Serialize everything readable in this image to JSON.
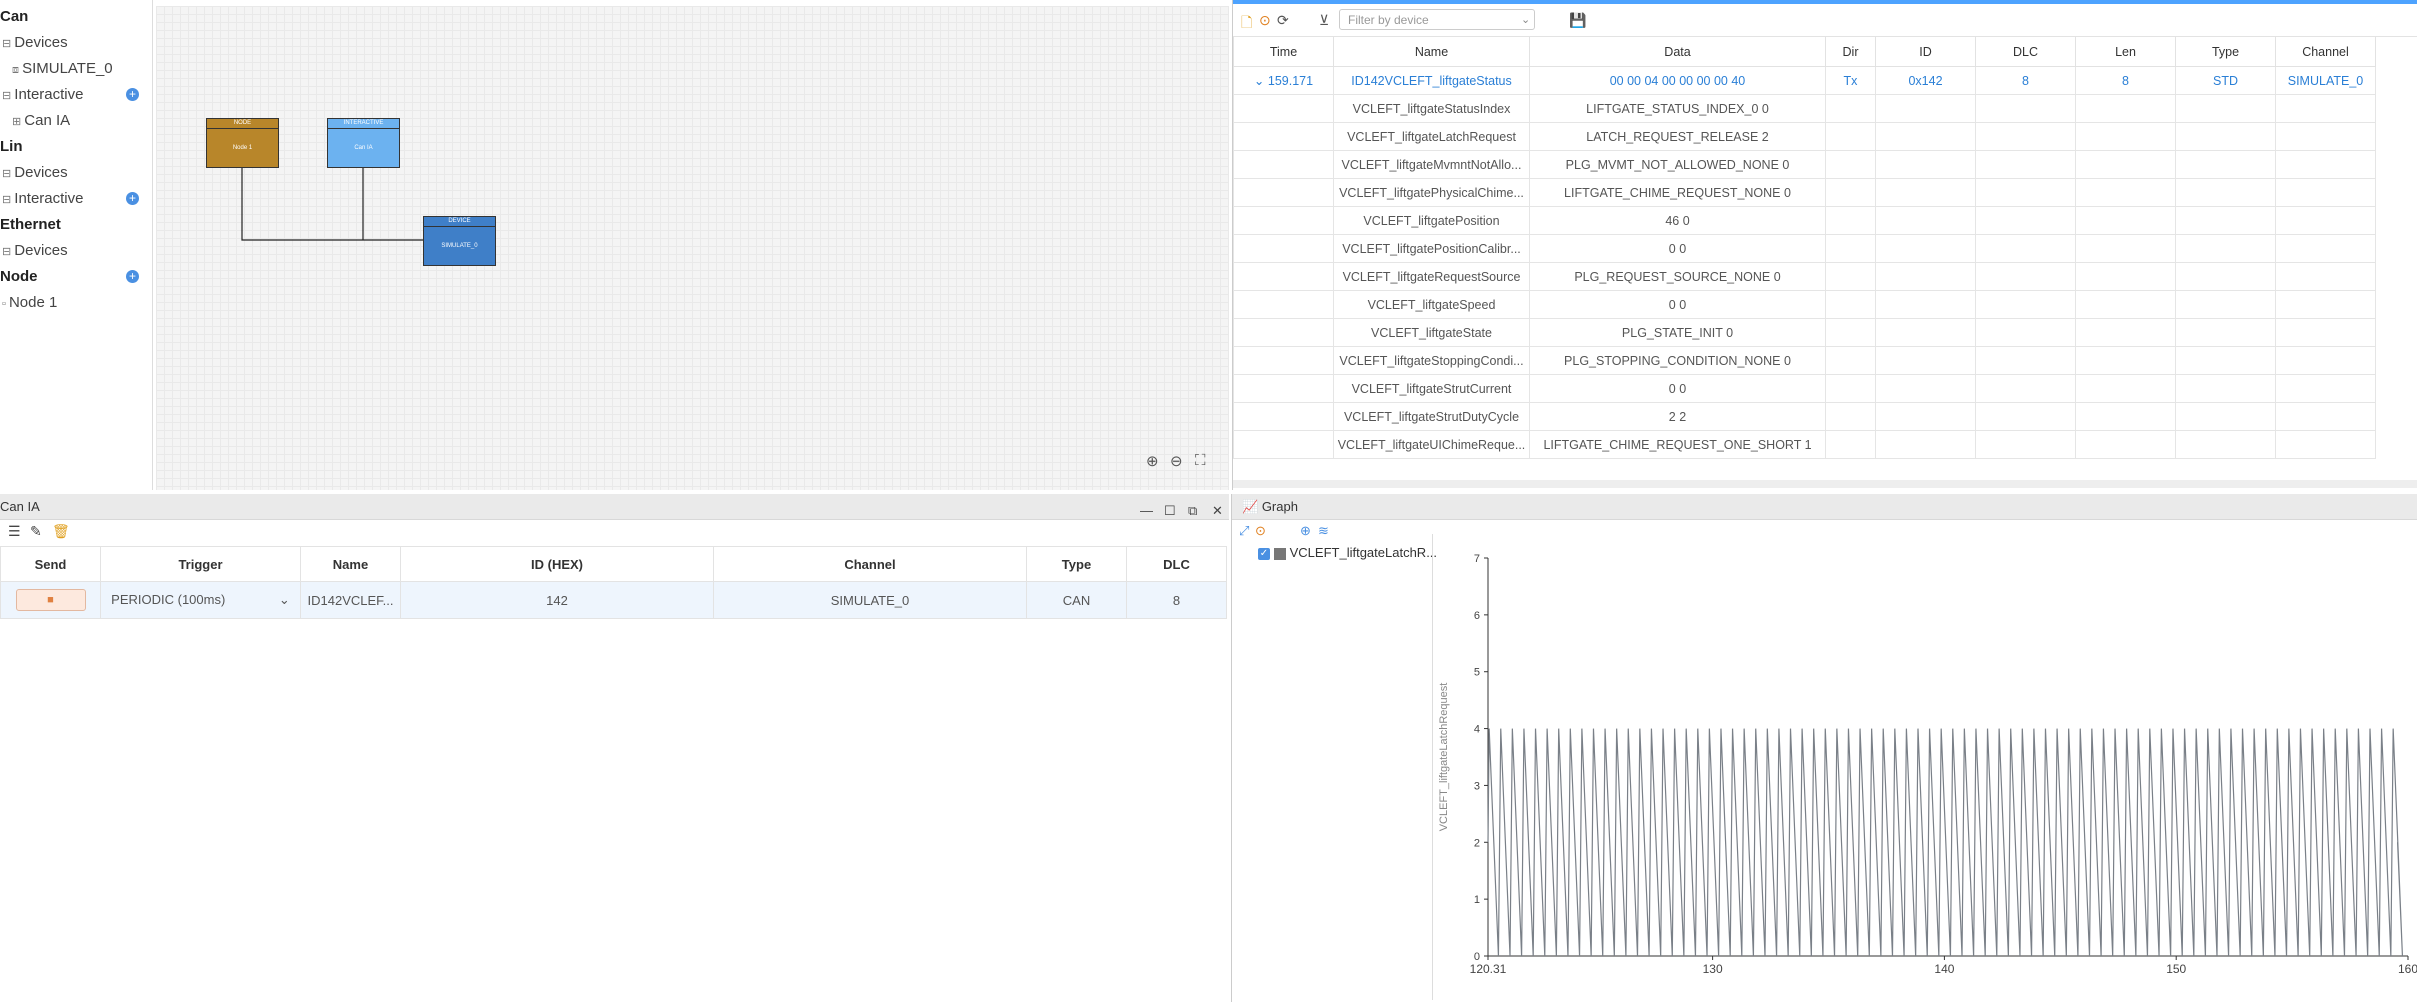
{
  "tree": {
    "sections": [
      {
        "label": "Can",
        "items": [
          {
            "label": "Devices",
            "children": [
              "SIMULATE_0"
            ]
          },
          {
            "label": "Interactive",
            "plus": true,
            "children": [
              "Can IA"
            ]
          }
        ]
      },
      {
        "label": "Lin",
        "items": [
          {
            "label": "Devices"
          },
          {
            "label": "Interactive",
            "plus": true
          }
        ]
      },
      {
        "label": "Ethernet",
        "items": [
          {
            "label": "Devices"
          }
        ]
      },
      {
        "label": "Node",
        "plus": true,
        "items": [
          {
            "label": "Node 1"
          }
        ]
      }
    ]
  },
  "canvas": {
    "nodes": [
      {
        "header": "NODE",
        "label": "Node 1",
        "color": "#b8862a"
      },
      {
        "header": "INTERACTIVE",
        "label": "Can IA",
        "color": "#6cb2f0"
      },
      {
        "header": "DEVICE",
        "label": "SIMULATE_0",
        "color": "#3f7fc8"
      }
    ]
  },
  "messages": {
    "filter_placeholder": "Filter by device",
    "columns": [
      "Time",
      "Name",
      "Data",
      "Dir",
      "ID",
      "DLC",
      "Len",
      "Type",
      "Channel"
    ],
    "main": {
      "time": "159.171",
      "name": "ID142VCLEFT_liftgateStatus",
      "data": "00 00 04 00 00 00 00 40",
      "dir": "Tx",
      "id": "0x142",
      "dlc": "8",
      "len": "8",
      "type": "STD",
      "channel": "SIMULATE_0"
    },
    "signals": [
      {
        "name": "VCLEFT_liftgateStatusIndex",
        "value": "LIFTGATE_STATUS_INDEX_0  0"
      },
      {
        "name": "VCLEFT_liftgateLatchRequest",
        "value": "LATCH_REQUEST_RELEASE  2"
      },
      {
        "name": "VCLEFT_liftgateMvmntNotAllo...",
        "value": "PLG_MVMT_NOT_ALLOWED_NONE  0"
      },
      {
        "name": "VCLEFT_liftgatePhysicalChime...",
        "value": "LIFTGATE_CHIME_REQUEST_NONE  0"
      },
      {
        "name": "VCLEFT_liftgatePosition",
        "value": "46  0"
      },
      {
        "name": "VCLEFT_liftgatePositionCalibr...",
        "value": "0  0"
      },
      {
        "name": "VCLEFT_liftgateRequestSource",
        "value": "PLG_REQUEST_SOURCE_NONE  0"
      },
      {
        "name": "VCLEFT_liftgateSpeed",
        "value": "0  0"
      },
      {
        "name": "VCLEFT_liftgateState",
        "value": "PLG_STATE_INIT  0"
      },
      {
        "name": "VCLEFT_liftgateStoppingCondi...",
        "value": "PLG_STOPPING_CONDITION_NONE  0"
      },
      {
        "name": "VCLEFT_liftgateStrutCurrent",
        "value": "0  0"
      },
      {
        "name": "VCLEFT_liftgateStrutDutyCycle",
        "value": "2  2"
      },
      {
        "name": "VCLEFT_liftgateUIChimeReque...",
        "value": "LIFTGATE_CHIME_REQUEST_ONE_SHORT  1"
      }
    ]
  },
  "canIA": {
    "title": "Can IA",
    "columns": [
      "Send",
      "Trigger",
      "Name",
      "ID (HEX)",
      "Channel",
      "Type",
      "DLC"
    ],
    "rows": [
      {
        "send": "■",
        "trigger": "PERIODIC   (100ms)",
        "name": "ID142VCLEF...",
        "id": "142",
        "channel": "SIMULATE_0",
        "type": "CAN",
        "dlc": "8"
      }
    ]
  },
  "graph": {
    "title": "Graph",
    "legend": "VCLEFT_liftgateLatchR...",
    "series_color": "#7a8088"
  },
  "chart_data": {
    "type": "line",
    "title": "",
    "xlabel": "",
    "ylabel": "VCLEFT_liftgateLatchRequest",
    "xlim": [
      120.31,
      160
    ],
    "ylim": [
      0,
      7
    ],
    "xticks": [
      "120.31",
      "130",
      "140",
      "150",
      "160"
    ],
    "yticks": [
      "0",
      "1",
      "2",
      "3",
      "4",
      "5",
      "6",
      "7"
    ],
    "series": [
      {
        "name": "VCLEFT_liftgateLatchR...",
        "pattern": "sawtooth",
        "x_start": 120.31,
        "x_end": 159.4,
        "period": 0.5,
        "min": 0,
        "max": 4
      }
    ]
  }
}
